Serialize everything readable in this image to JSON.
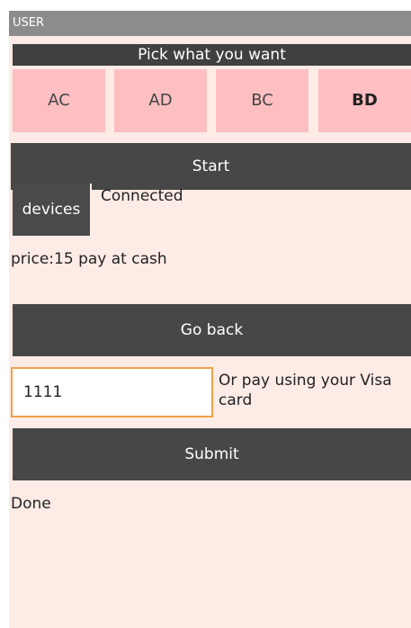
{
  "app": {
    "title": "USER"
  },
  "pick": {
    "header": "Pick what you want",
    "options": [
      "AC",
      "AD",
      "BC",
      "BD"
    ],
    "selected": "BD"
  },
  "buttons": {
    "start": "Start",
    "devices": "devices",
    "go_back": "Go back",
    "submit": "Submit"
  },
  "status": {
    "connection": "Connected",
    "price": "price:15 pay at cash",
    "done": "Done"
  },
  "payment": {
    "card_value": "1111",
    "label": "Or pay using your Visa card"
  },
  "colors": {
    "background": "#fdebe6",
    "button_dark": "#474747",
    "choice_pink": "#fdbfc2",
    "input_focus": "#f0a04a"
  }
}
